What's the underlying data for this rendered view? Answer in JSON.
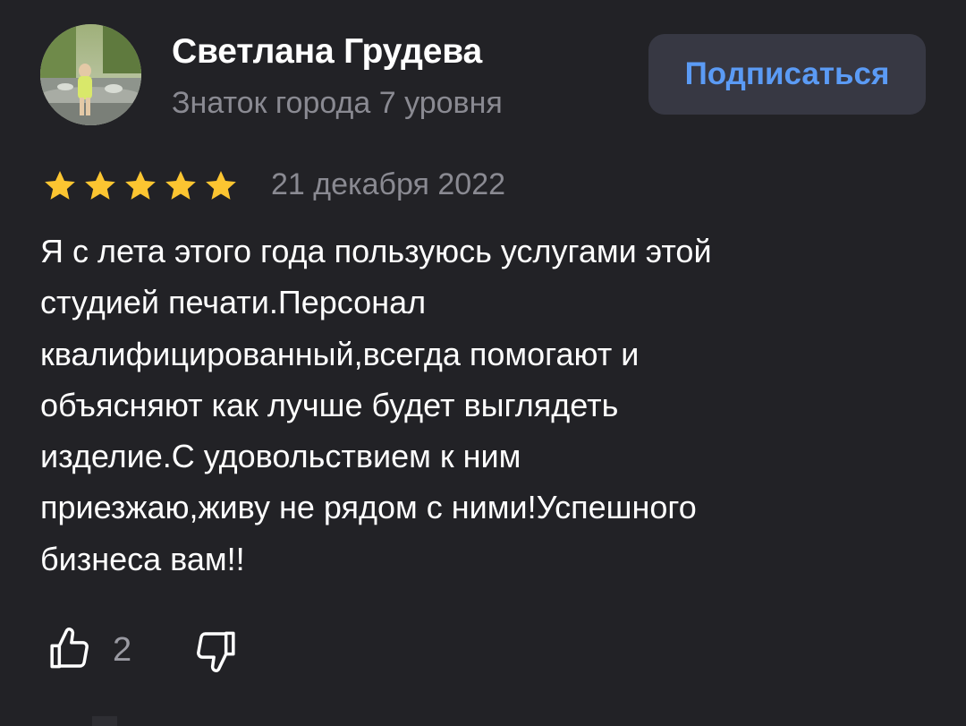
{
  "author": {
    "name": "Светлана Грудева",
    "level": "Знаток города 7 уровня"
  },
  "subscribe": {
    "label": "Подписаться"
  },
  "rating": {
    "stars": 5,
    "max": 5,
    "date": "21 декабря 2022"
  },
  "review": {
    "lines": [
      "Я с лета этого года пользуюсь услугами этой",
      "студией печати.Персонал",
      "квалифицированный,всегда помогают и",
      "объясняют как лучше будет выглядеть",
      "изделие.С удовольствием к ним",
      "приезжаю,живу не рядом с ними!Успешного",
      "бизнеса вам!!"
    ]
  },
  "reactions": {
    "like_icon": "thumbs-up-icon",
    "likes": "2",
    "dislike_icon": "thumbs-down-icon"
  },
  "colors": {
    "background": "#222226",
    "accent": "#5b9bf5",
    "star": "#fcc531",
    "muted": "#8a8a92",
    "button_bg": "#373843"
  }
}
